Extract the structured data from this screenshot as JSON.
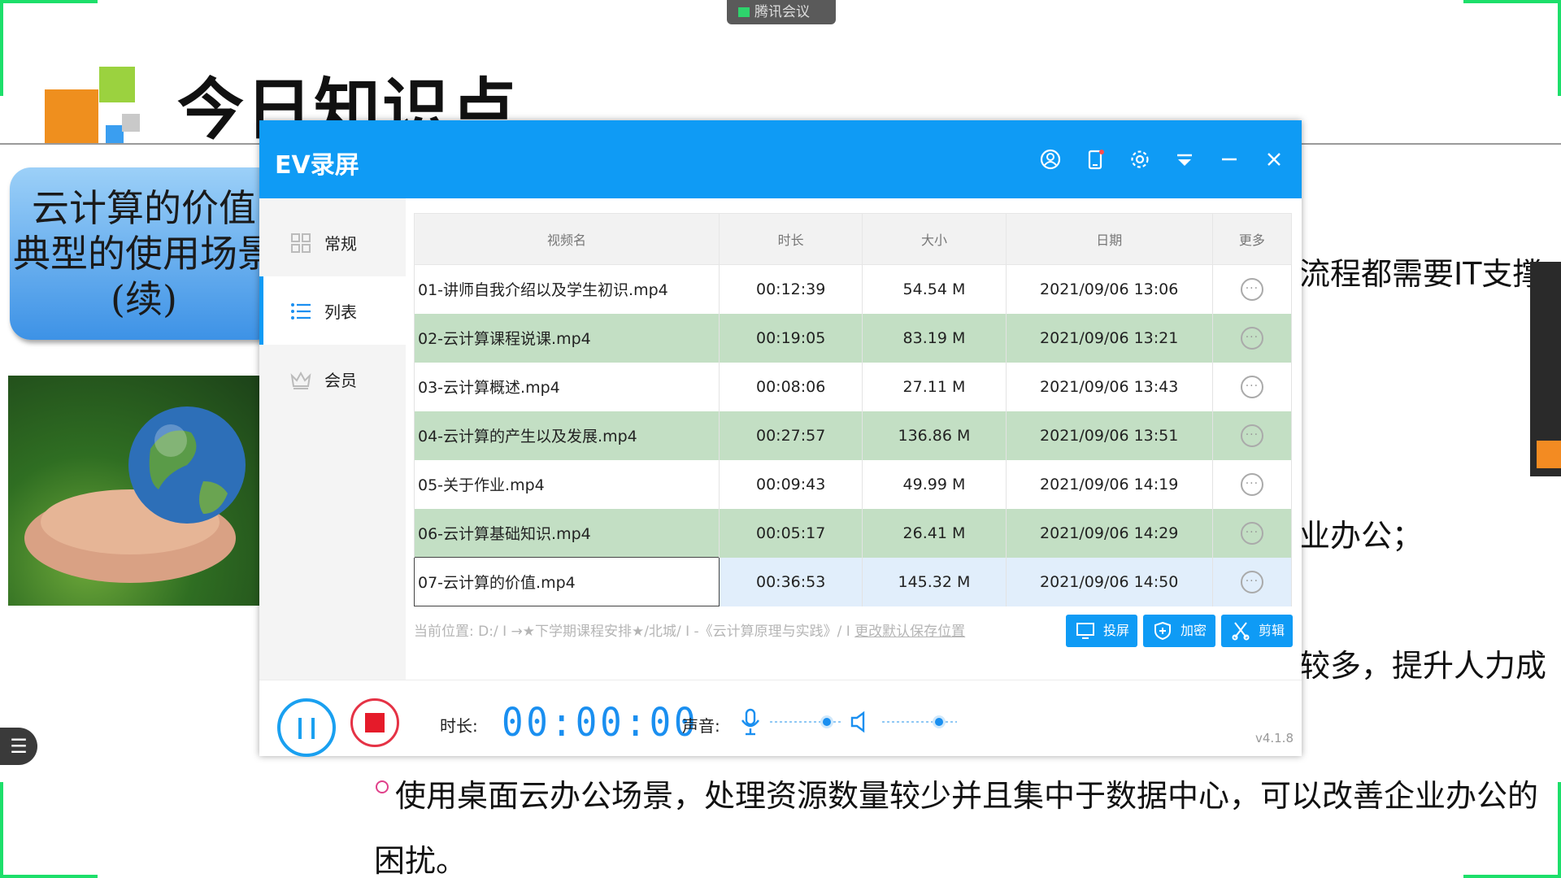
{
  "meeting_badge": "腾讯会议",
  "slide": {
    "title": "今日知识点",
    "box_lines": [
      "云计算的价值",
      "典型的使用场景",
      "(续)"
    ],
    "text_right_1": "流程都需要IT支撑",
    "text_right_2": "业办公；",
    "text_right_3": "较多，提升人力成",
    "bullet_line_1": "使用桌面云办公场景，处理资源数量较少并且集中于数据中心，可以改善企业办公的",
    "bullet_line_2": "困扰。"
  },
  "ev": {
    "title": "EV录屏",
    "header_icons": [
      "user-icon",
      "phone-icon",
      "gear-icon",
      "dropdown-icon",
      "minimize-icon",
      "close-icon"
    ],
    "sidebar": [
      {
        "label": "常规",
        "icon": "grid-icon"
      },
      {
        "label": "列表",
        "icon": "list-icon"
      },
      {
        "label": "会员",
        "icon": "crown-icon"
      }
    ],
    "columns": [
      "视频名",
      "时长",
      "大小",
      "日期",
      "更多"
    ],
    "rows": [
      {
        "name": "01-讲师自我介绍以及学生初识.mp4",
        "duration": "00:12:39",
        "size": "54.54 M",
        "date": "2021/09/06 13:06"
      },
      {
        "name": "02-云计算课程说课.mp4",
        "duration": "00:19:05",
        "size": "83.19 M",
        "date": "2021/09/06 13:21"
      },
      {
        "name": "03-云计算概述.mp4",
        "duration": "00:08:06",
        "size": "27.11 M",
        "date": "2021/09/06 13:43"
      },
      {
        "name": "04-云计算的产生以及发展.mp4",
        "duration": "00:27:57",
        "size": "136.86 M",
        "date": "2021/09/06 13:51"
      },
      {
        "name": "05-关于作业.mp4",
        "duration": "00:09:43",
        "size": "49.99 M",
        "date": "2021/09/06 14:19"
      },
      {
        "name": "06-云计算基础知识.mp4",
        "duration": "00:05:17",
        "size": "26.41 M",
        "date": "2021/09/06 14:29"
      },
      {
        "name": "07-云计算的价值.mp4",
        "duration": "00:36:53",
        "size": "145.32 M",
        "date": "2021/09/06 14:50"
      }
    ],
    "path_text": "当前位置: D:/ I →★下学期课程安排★/北城/ I -《云计算原理与实践》/ I",
    "path_link": "更改默认保存位置",
    "buttons": {
      "cast": "投屏",
      "encrypt": "加密",
      "edit": "剪辑"
    },
    "duration_label": "时长:",
    "timer": "00:00:00",
    "sound_label": "声音:",
    "version": "v4.1.8"
  }
}
